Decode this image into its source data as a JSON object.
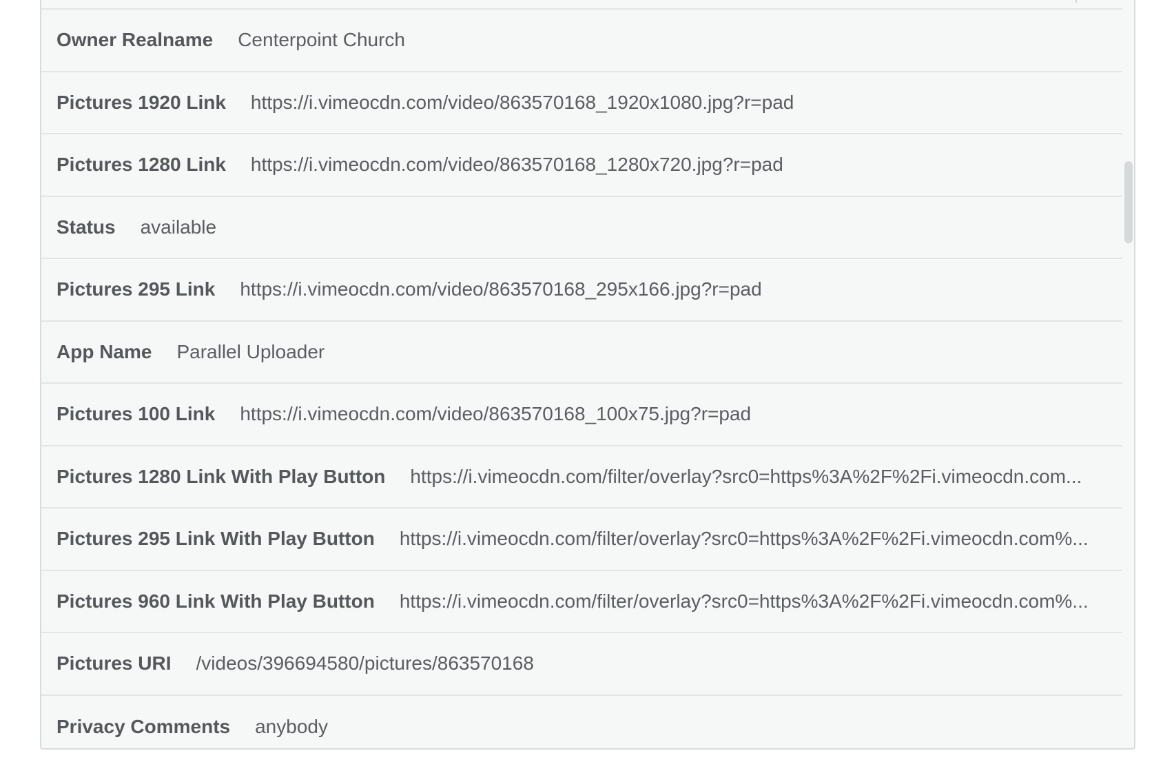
{
  "fields": [
    {
      "label": "Owner Realname",
      "value": "Centerpoint Church"
    },
    {
      "label": "Pictures 1920 Link",
      "value": "https://i.vimeocdn.com/video/863570168_1920x1080.jpg?r=pad"
    },
    {
      "label": "Pictures 1280 Link",
      "value": "https://i.vimeocdn.com/video/863570168_1280x720.jpg?r=pad"
    },
    {
      "label": "Status",
      "value": "available"
    },
    {
      "label": "Pictures 295 Link",
      "value": "https://i.vimeocdn.com/video/863570168_295x166.jpg?r=pad"
    },
    {
      "label": "App Name",
      "value": "Parallel Uploader"
    },
    {
      "label": "Pictures 100 Link",
      "value": "https://i.vimeocdn.com/video/863570168_100x75.jpg?r=pad"
    },
    {
      "label": "Pictures 1280 Link With Play Button",
      "value": "https://i.vimeocdn.com/filter/overlay?src0=https%3A%2F%2Fi.vimeocdn.com..."
    },
    {
      "label": "Pictures 295 Link With Play Button",
      "value": "https://i.vimeocdn.com/filter/overlay?src0=https%3A%2F%2Fi.vimeocdn.com%..."
    },
    {
      "label": "Pictures 960 Link With Play Button",
      "value": "https://i.vimeocdn.com/filter/overlay?src0=https%3A%2F%2Fi.vimeocdn.com%..."
    },
    {
      "label": "Pictures URI",
      "value": "/videos/396694580/pictures/863570168"
    },
    {
      "label": "Privacy Comments",
      "value": "anybody"
    }
  ]
}
